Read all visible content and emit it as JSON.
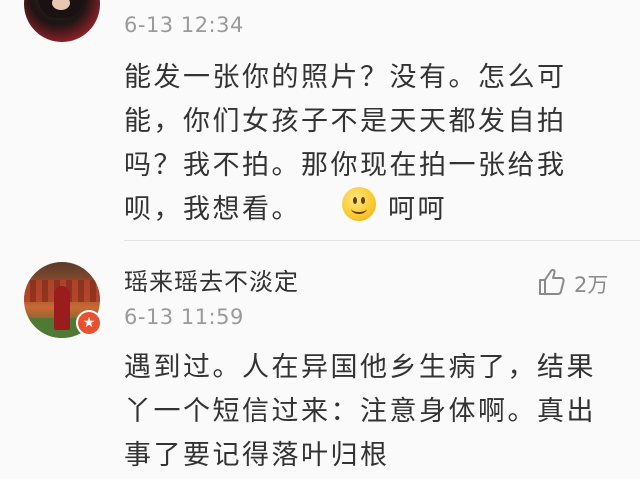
{
  "comments": [
    {
      "time": "6-13 12:34",
      "lines": [
        "能发一张你的照片？没有。怎么可",
        "能，你们女孩子不是天天都发自拍",
        "吗？我不拍。那你现在拍一张给我",
        "呗，我想看。"
      ],
      "emoji": "smile-emoji",
      "emoji_text": "呵呵"
    },
    {
      "username": "瑶来瑶去不淡定",
      "time": "6-13 11:59",
      "likes": "2万",
      "badge_icon": "verified-star-badge",
      "lines": [
        "遇到过。人在异国他乡生病了，结果",
        "丫一个短信过来：注意身体啊。真出",
        "事了要记得落叶归根"
      ]
    }
  ],
  "colors": {
    "text": "#333333",
    "meta": "#9a9a9a",
    "badge": "#e8512f",
    "divider": "#e2e2e2",
    "background": "#fafafa"
  }
}
